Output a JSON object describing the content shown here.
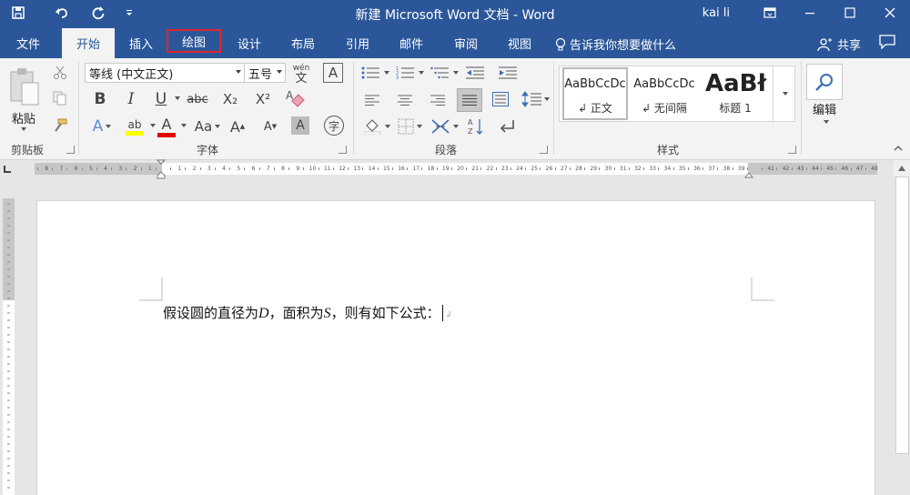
{
  "window": {
    "title": "新建 Microsoft Word 文档 - Word",
    "user": "kai li"
  },
  "tabs": [
    "文件",
    "开始",
    "插入",
    "绘图",
    "设计",
    "布局",
    "引用",
    "邮件",
    "审阅",
    "视图"
  ],
  "active_tab": "开始",
  "highlighted_tab": "绘图",
  "tell_me": "告诉我你想要做什么",
  "share_label": "共享",
  "ribbon": {
    "clipboard": {
      "paste_label": "粘贴",
      "group_label": "剪贴板"
    },
    "font": {
      "font_name": "等线 (中文正文)",
      "font_size": "五号",
      "phonetic_label": "wén",
      "phonetic_char": "文",
      "bold": "B",
      "italic": "I",
      "underline": "U",
      "strike": "abc",
      "subscript": "X₂",
      "superscript": "X²",
      "change_case": "Aa",
      "grow": "A",
      "shrink": "A",
      "enclose": "字",
      "highlight": "ab",
      "group_label": "字体"
    },
    "paragraph": {
      "group_label": "段落"
    },
    "styles": {
      "items": [
        {
          "sample": "AaBbCcDc",
          "name": "↲ 正文"
        },
        {
          "sample": "AaBbCcDc",
          "name": "↲ 无间隔"
        },
        {
          "sample": "AaBł",
          "name": "标题 1"
        }
      ],
      "group_label": "样式"
    },
    "editing": {
      "label": "编辑"
    }
  },
  "ruler": {
    "labels": [
      "8",
      "7",
      "6",
      "5",
      "4",
      "3",
      "2",
      "1",
      "",
      "1",
      "2",
      "3",
      "4",
      "5",
      "6",
      "7",
      "8",
      "9",
      "10",
      "11",
      "12",
      "13",
      "14",
      "15",
      "16",
      "17",
      "18",
      "19",
      "20",
      "21",
      "22",
      "23",
      "24",
      "25",
      "26",
      "27",
      "28",
      "29",
      "30",
      "31",
      "32",
      "33",
      "34",
      "35",
      "36",
      "37",
      "38",
      "39",
      "",
      "41",
      "42",
      "43",
      "44",
      "45",
      "46",
      "47",
      "48"
    ]
  },
  "document": {
    "p1": "假设圆的直径为",
    "var_d": "D",
    "p2": "，面积为",
    "var_s": "S",
    "p3": "，则有如下公式：",
    "para_mark": "↲"
  },
  "colors": {
    "accent": "#2b579a",
    "highlight_yellow": "#ffff00",
    "font_red": "#e00000",
    "tab_outline": "#e0262a"
  }
}
